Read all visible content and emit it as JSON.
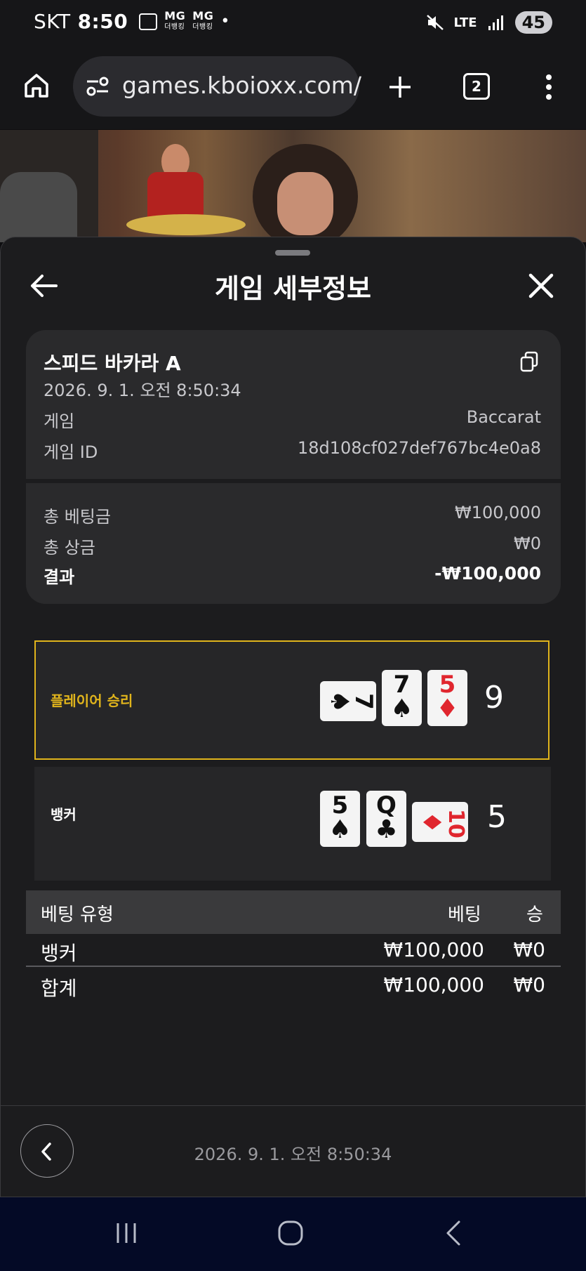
{
  "status_bar": {
    "carrier": "SKT",
    "time": "8:50",
    "notif_mg1": "MG",
    "notif_mg2": "MG",
    "notif_sub1": "더뱅킹",
    "notif_sub2": "더뱅킹",
    "network": "LTE",
    "battery": "45"
  },
  "browser": {
    "url": "games.kboioxx.com/",
    "tab_count": "2"
  },
  "sheet": {
    "title": "게임 세부정보"
  },
  "game": {
    "name": "스피드 바카라 A",
    "datetime": "2026. 9. 1. 오전 8:50:34",
    "game_label": "게임",
    "game_value": "Baccarat",
    "id_label": "게임 ID",
    "id_value": "18d108cf027def767bc4e0a8"
  },
  "summary": {
    "total_bet_label": "총 베팅금",
    "total_bet_value": "₩100,000",
    "total_win_label": "총 상금",
    "total_win_value": "₩0",
    "result_label": "결과",
    "result_value": "-₩100,000"
  },
  "hands": {
    "player": {
      "label": "플레이어 승리",
      "score": "9",
      "cards": [
        {
          "rank": "7",
          "suit": "♠",
          "color": "black",
          "rotated": true
        },
        {
          "rank": "7",
          "suit": "♠",
          "color": "black",
          "rotated": false
        },
        {
          "rank": "5",
          "suit": "♦",
          "color": "red",
          "rotated": false
        }
      ]
    },
    "banker": {
      "label": "뱅커",
      "score": "5",
      "cards": [
        {
          "rank": "5",
          "suit": "♠",
          "color": "black",
          "rotated": false
        },
        {
          "rank": "Q",
          "suit": "♣",
          "color": "black",
          "rotated": false
        },
        {
          "rank": "10",
          "suit": "♦",
          "color": "red",
          "rotated": true
        }
      ]
    }
  },
  "bets": {
    "headers": {
      "type": "베팅 유형",
      "bet": "베팅",
      "win": "승"
    },
    "rows": [
      {
        "type": "뱅커",
        "bet": "₩100,000",
        "win": "₩0"
      }
    ],
    "total": {
      "type": "합계",
      "bet": "₩100,000",
      "win": "₩0"
    }
  },
  "footer": {
    "datetime": "2026. 9. 1. 오전 8:50:34"
  },
  "colors": {
    "accent": "#e0b41c",
    "card_red": "#e0262e",
    "sheet_bg": "#1c1c1e",
    "nav_bg": "#040a26"
  }
}
